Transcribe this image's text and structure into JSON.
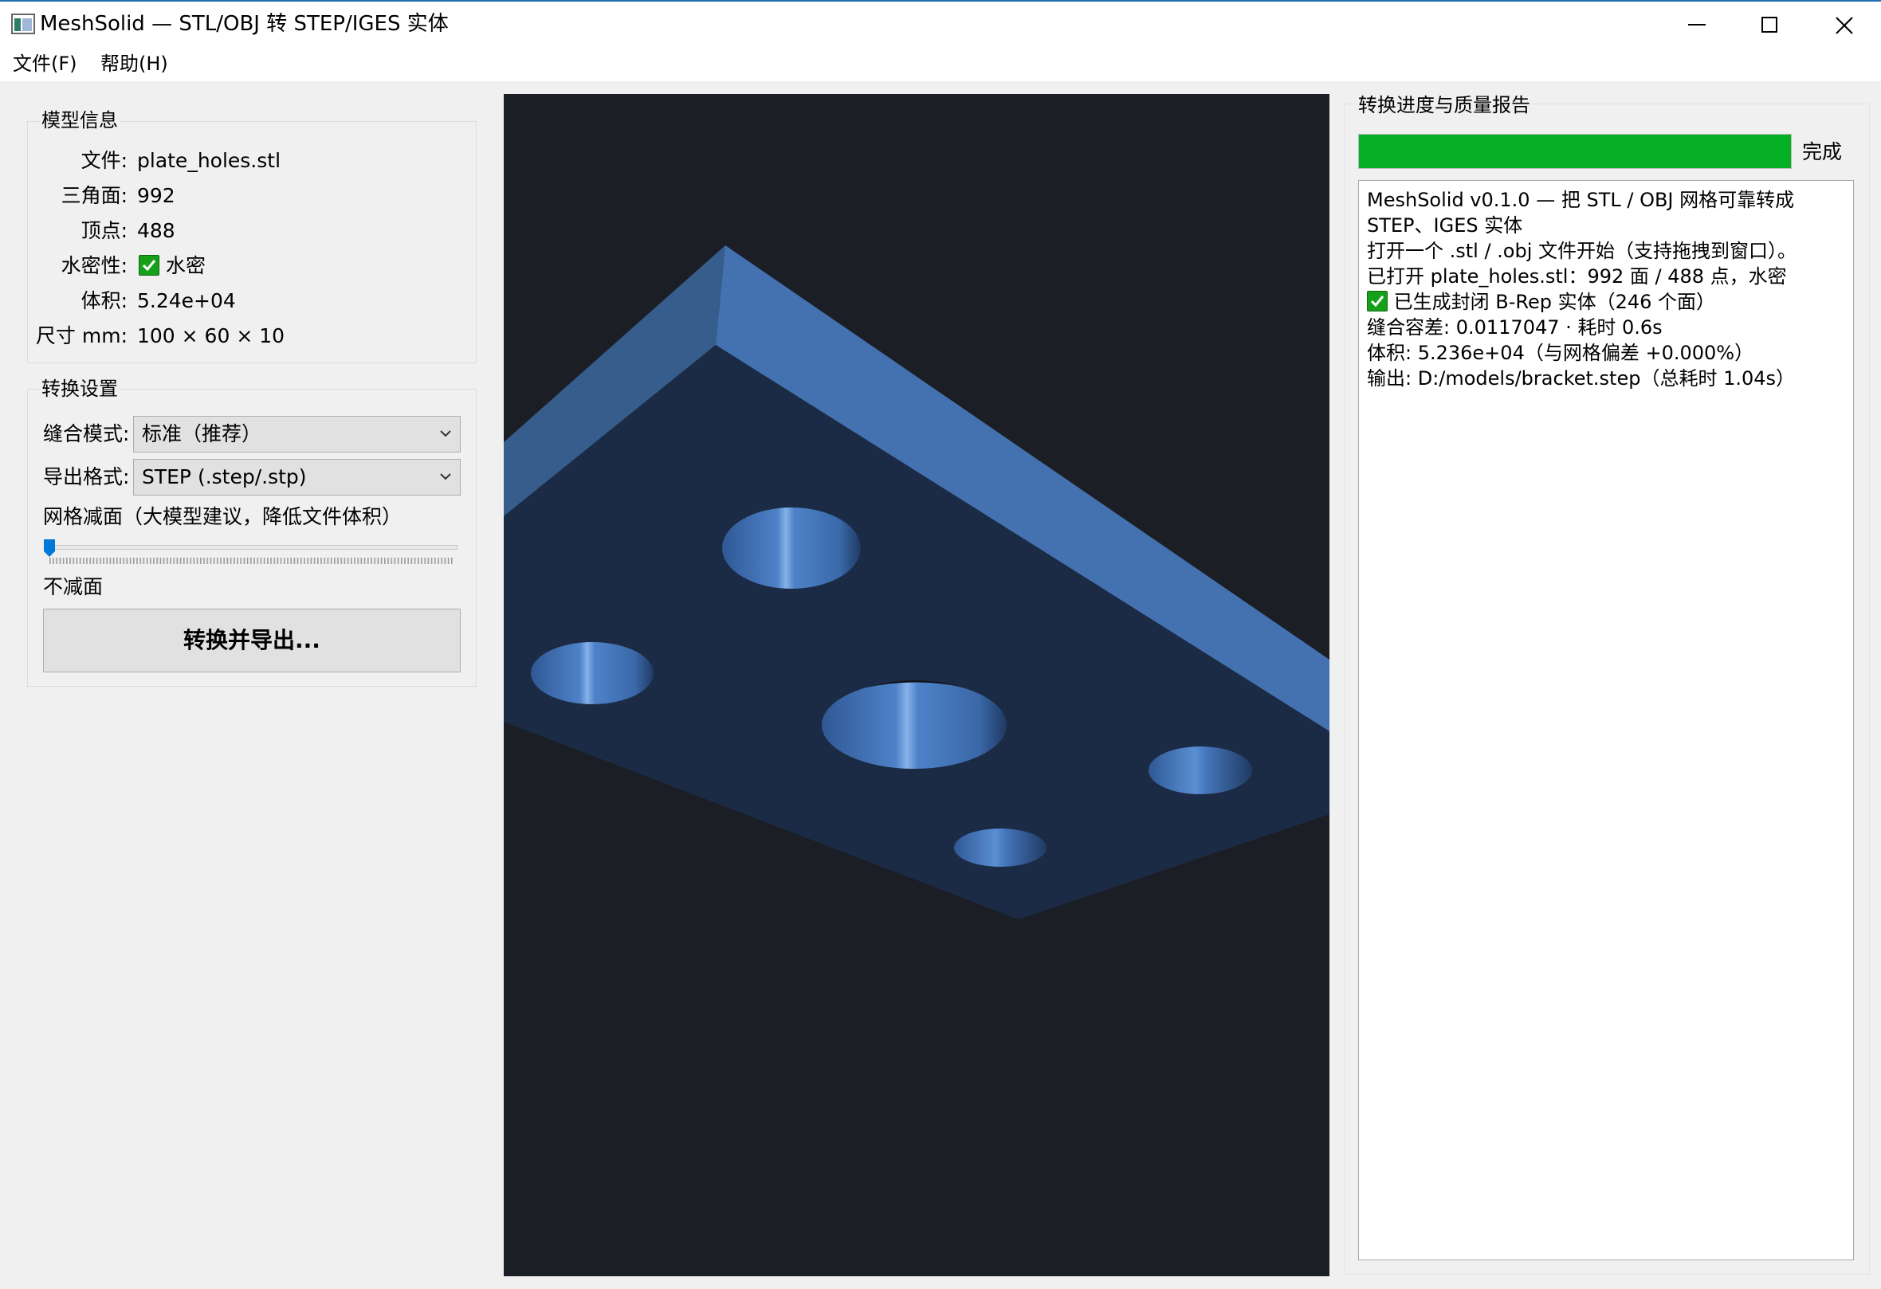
{
  "window": {
    "title": "MeshSolid — STL/OBJ 转 STEP/IGES 实体"
  },
  "menu": {
    "file": "文件(F)",
    "help": "帮助(H)"
  },
  "model_info": {
    "title": "模型信息",
    "rows": [
      {
        "label": "文件:",
        "value": "plate_holes.stl"
      },
      {
        "label": "三角面:",
        "value": "992"
      },
      {
        "label": "顶点:",
        "value": "488"
      },
      {
        "label": "水密性:",
        "value": "水密",
        "icon": "checkmark-icon"
      },
      {
        "label": "体积:",
        "value": "5.24e+04"
      },
      {
        "label": "尺寸 mm:",
        "value": "100 × 60 × 10"
      }
    ]
  },
  "settings": {
    "title": "转换设置",
    "sew_mode_label": "缝合模式:",
    "sew_mode_value": "标准（推荐）",
    "export_format_label": "导出格式:",
    "export_format_value": "STEP (.step/.stp)",
    "decimation_label": "网格减面（大模型建议，降低文件体积）",
    "decimation_level": 0,
    "decimation_value_text": "不减面",
    "convert_button": "转换并导出..."
  },
  "report": {
    "title": "转换进度与质量报告",
    "progress": 1.0,
    "progress_text": "完成",
    "log": [
      "MeshSolid v0.1.0 — 把 STL / OBJ 网格可靠转成",
      "STEP、IGES 实体",
      "打开一个 .stl / .obj 文件开始（支持拖拽到窗口）。",
      "已打开 plate_holes.stl：992 面 / 488 点，水密",
      "已生成封闭 B-Rep 实体（246 个面）",
      "缝合容差: 0.0117047 · 耗时 0.6s",
      "体积: 5.236e+04（与网格偏差 +0.000%）",
      "输出: D:/models/bracket.step（总耗时 1.04s）"
    ]
  },
  "colors": {
    "accent": "#1f6fb3",
    "progress": "#06b025",
    "viewport_bg": "#1b1e24",
    "model": "#4472b0"
  }
}
